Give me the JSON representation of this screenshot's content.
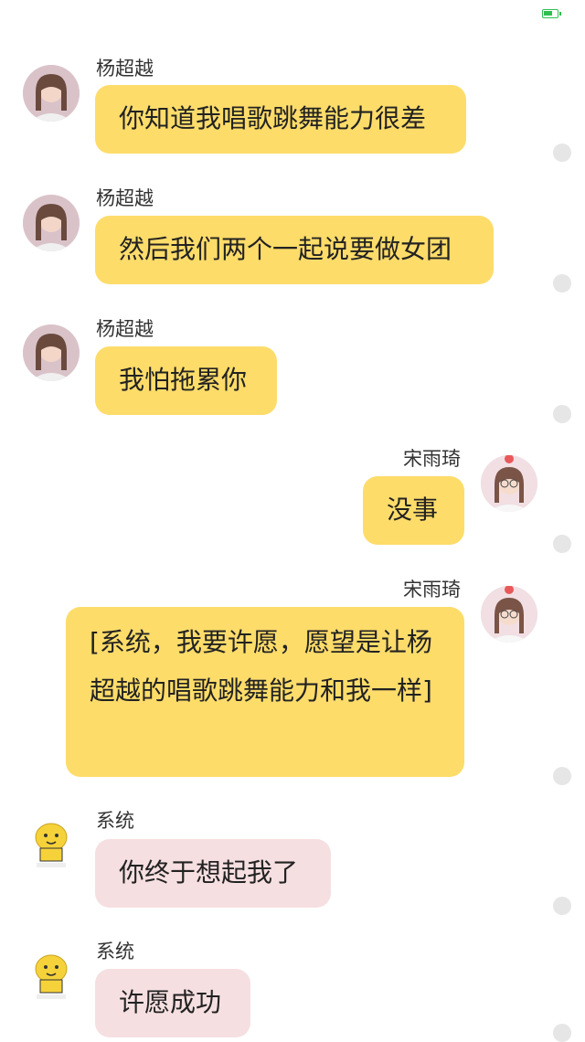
{
  "status": {
    "battery_color": "#2fbf4f"
  },
  "colors": {
    "bubble_user": "#fddc6a",
    "bubble_system": "#f6dfe1"
  },
  "messages": [
    {
      "sender": "杨超越",
      "text": "你知道我唱歌跳舞能力很差",
      "side": "left",
      "avatar": "girl-avatar-icon"
    },
    {
      "sender": "杨超越",
      "text": "然后我们两个一起说要做女团",
      "side": "left",
      "avatar": "girl-avatar-icon"
    },
    {
      "sender": "杨超越",
      "text": "我怕拖累你",
      "side": "left",
      "avatar": "girl-avatar-icon"
    },
    {
      "sender": "宋雨琦",
      "text": "没事",
      "side": "right",
      "avatar": "glasses-girl-avatar-icon"
    },
    {
      "sender": "宋雨琦",
      "text": "[系统，我要许愿，愿望是让杨超越的唱歌跳舞能力和我一样]",
      "side": "right",
      "avatar": "glasses-girl-avatar-icon"
    },
    {
      "sender": "系统",
      "text": "你终于想起我了",
      "side": "left",
      "avatar": "yellow-cartoon-avatar-icon"
    },
    {
      "sender": "系统",
      "text": "许愿成功",
      "side": "left",
      "avatar": "yellow-cartoon-avatar-icon"
    }
  ]
}
